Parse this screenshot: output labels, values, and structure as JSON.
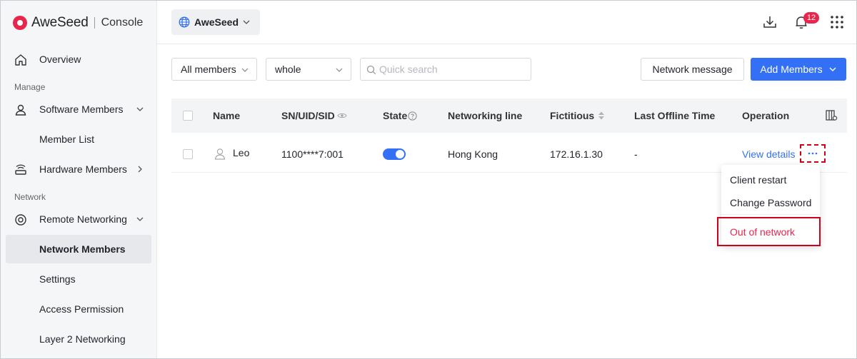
{
  "brand": {
    "name": "AweSeed",
    "console": "Console"
  },
  "sidebar": {
    "groups": {
      "manage": "Manage",
      "network": "Network"
    },
    "items": [
      {
        "label": "Overview"
      },
      {
        "label": "Software Members"
      },
      {
        "label": "Member List"
      },
      {
        "label": "Hardware Members"
      },
      {
        "label": "Remote Networking"
      },
      {
        "label": "Network Members"
      },
      {
        "label": "Settings"
      },
      {
        "label": "Access Permission"
      },
      {
        "label": "Layer 2 Networking"
      }
    ],
    "active": "Network Members"
  },
  "header": {
    "workspace": "AweSeed",
    "notification_count": "12",
    "icons": [
      "download-icon",
      "bell-icon",
      "apps-grid-icon"
    ]
  },
  "toolbar": {
    "member_filter": "All members",
    "scope_filter": "whole",
    "search_placeholder": "Quick search",
    "network_message": "Network message",
    "add_members": "Add Members"
  },
  "table": {
    "columns": {
      "name": "Name",
      "sn": "SN/UID/SID",
      "state": "State",
      "networking_line": "Networking line",
      "fictitious": "Fictitious",
      "last_offline": "Last Offline Time",
      "operation": "Operation"
    },
    "rows": [
      {
        "name": "Leo",
        "sn": "1100****7:001",
        "state_on": true,
        "networking_line": "Hong Kong",
        "fictitious": "172.16.1.30",
        "last_offline": "-",
        "view_details": "View details"
      }
    ]
  },
  "menu": {
    "items": [
      {
        "label": "Client restart"
      },
      {
        "label": "Change Password"
      },
      {
        "label": "Out of network"
      }
    ]
  },
  "colors": {
    "accent": "#3370f5",
    "brand": "#e8254b",
    "highlight": "#d0021b"
  }
}
